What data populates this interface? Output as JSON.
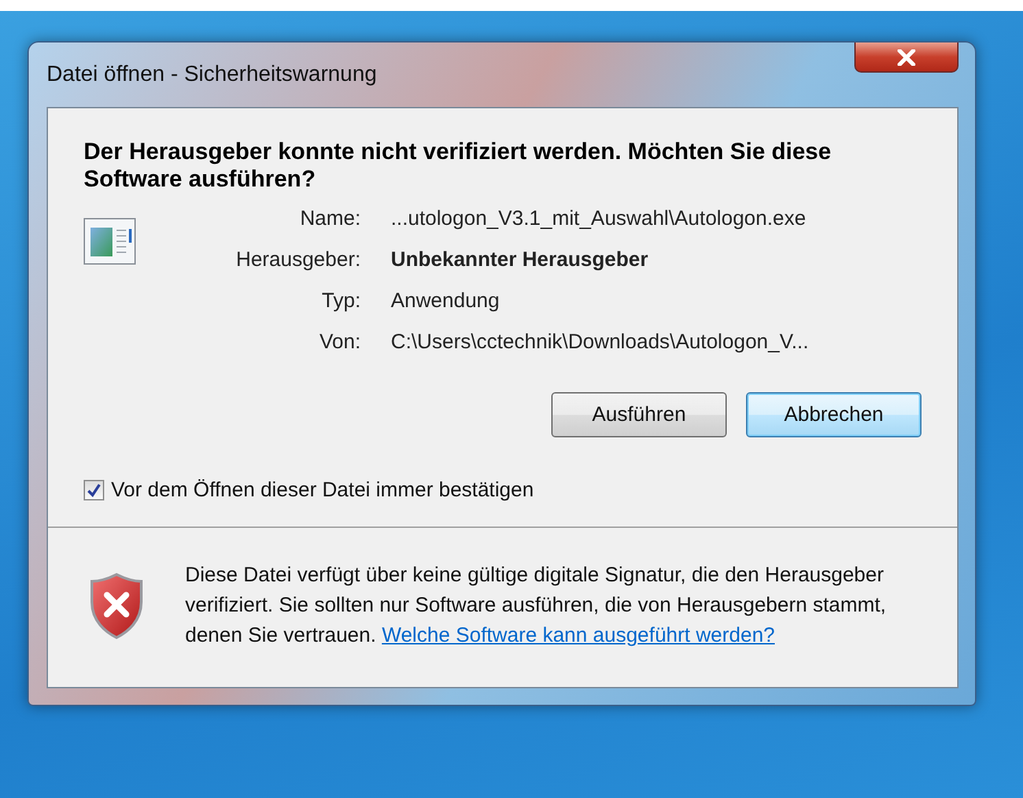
{
  "window": {
    "title": "Datei öffnen - Sicherheitswarnung"
  },
  "heading": "Der Herausgeber konnte nicht verifiziert werden. Möchten Sie diese Software ausführen?",
  "details": [
    {
      "label": "Name:",
      "value": "...utologon_V3.1_mit_Auswahl\\Autologon.exe",
      "bold": false
    },
    {
      "label": "Herausgeber:",
      "value": "Unbekannter Herausgeber",
      "bold": true
    },
    {
      "label": "Typ:",
      "value": "Anwendung",
      "bold": false
    },
    {
      "label": "Von:",
      "value": "C:\\Users\\cctechnik\\Downloads\\Autologon_V...",
      "bold": false
    }
  ],
  "buttons": [
    {
      "label": "Ausführen",
      "focused": false
    },
    {
      "label": "Abbrechen",
      "focused": true
    }
  ],
  "checkbox": {
    "label": "Vor dem Öffnen dieser Datei immer bestätigen",
    "checked": true
  },
  "warning": {
    "text": "Diese Datei verfügt über keine gültige digitale Signatur, die den Herausgeber verifiziert. Sie sollten nur Software ausführen, die von Herausgebern stammt, denen Sie vertrauen.",
    "link": "Welche Software kann ausgeführt werden?"
  }
}
